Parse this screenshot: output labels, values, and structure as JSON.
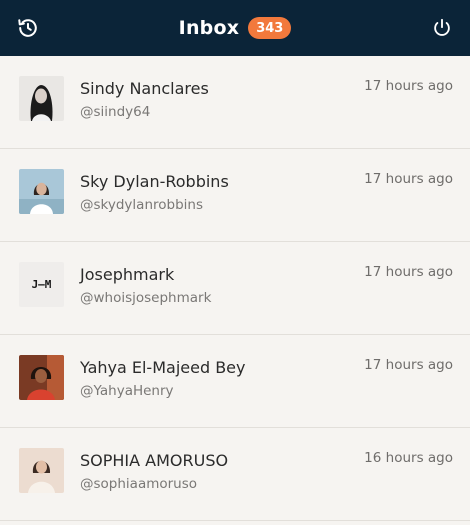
{
  "header": {
    "title": "Inbox",
    "count": "343",
    "left_icon": "history-icon",
    "right_icon": "power-icon"
  },
  "messages": [
    {
      "name": "Sindy Nanclares",
      "handle": "@siindy64",
      "time": "17 hours ago",
      "avatar": "photo"
    },
    {
      "name": "Sky Dylan-Robbins",
      "handle": "@skydylanrobbins",
      "time": "17 hours ago",
      "avatar": "photo"
    },
    {
      "name": "Josephmark",
      "handle": "@whoisjosephmark",
      "time": "17 hours ago",
      "avatar": "J—M"
    },
    {
      "name": "Yahya El-Majeed Bey",
      "handle": "@YahyaHenry",
      "time": "17 hours ago",
      "avatar": "photo"
    },
    {
      "name": "SOPHIA AMORUSO",
      "handle": "@sophiaamoruso",
      "time": "16 hours ago",
      "avatar": "photo"
    }
  ],
  "colors": {
    "header_bg": "#0b2438",
    "badge_bg": "#f2793c",
    "list_bg": "#f6f4f1"
  }
}
